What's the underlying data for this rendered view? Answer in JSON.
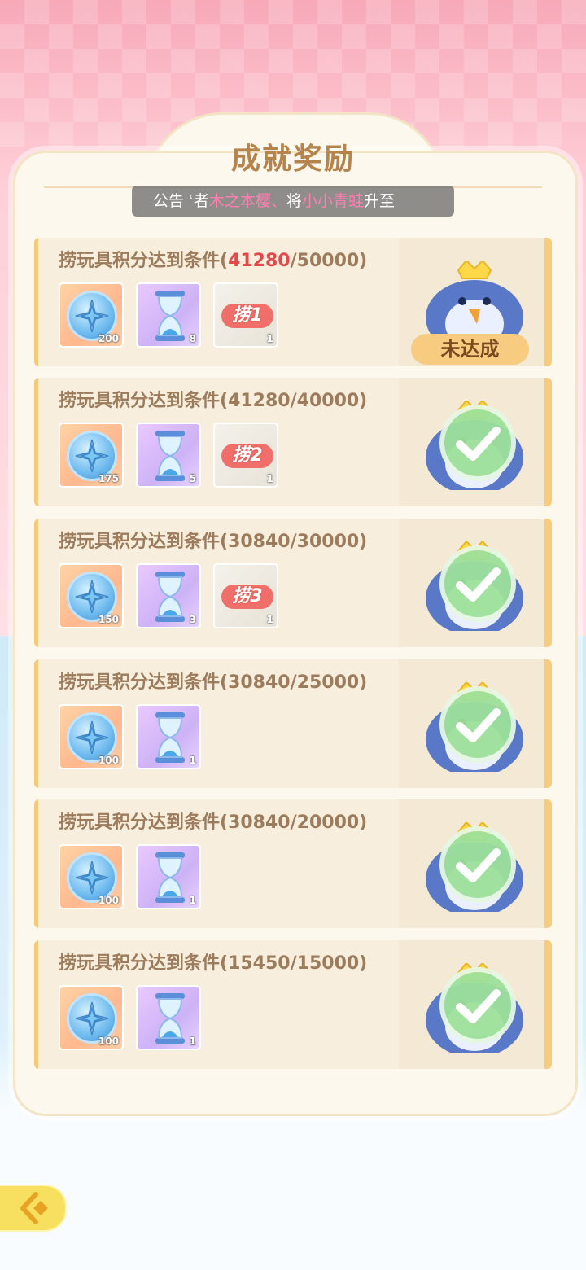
{
  "title": "成就奖励",
  "notice": {
    "label": "公告",
    "text_parts": [
      "ʿ者",
      "木之本樱、",
      "将",
      "小小青蛙",
      "升至"
    ]
  },
  "rows": [
    {
      "condition": "捞玩具积分达到条件(",
      "current": "41280",
      "target": "/50000)",
      "reached": false,
      "status": "未达成",
      "items": [
        {
          "type": "coin",
          "qty": "200"
        },
        {
          "type": "hourglass",
          "qty": "8"
        },
        {
          "type": "ticket",
          "label": "捞1",
          "qty": "1"
        }
      ]
    },
    {
      "condition": "捞玩具积分达到条件(",
      "current": "41280",
      "target": "/40000)",
      "reached": true,
      "items": [
        {
          "type": "coin",
          "qty": "175"
        },
        {
          "type": "hourglass",
          "qty": "5"
        },
        {
          "type": "ticket",
          "label": "捞2",
          "qty": "1"
        }
      ]
    },
    {
      "condition": "捞玩具积分达到条件(",
      "current": "30840",
      "target": "/30000)",
      "reached": true,
      "items": [
        {
          "type": "coin",
          "qty": "150"
        },
        {
          "type": "hourglass",
          "qty": "3"
        },
        {
          "type": "ticket",
          "label": "捞3",
          "qty": "1"
        }
      ]
    },
    {
      "condition": "捞玩具积分达到条件(",
      "current": "30840",
      "target": "/25000)",
      "reached": true,
      "items": [
        {
          "type": "coin",
          "qty": "100"
        },
        {
          "type": "hourglass",
          "qty": "1"
        }
      ]
    },
    {
      "condition": "捞玩具积分达到条件(",
      "current": "30840",
      "target": "/20000)",
      "reached": true,
      "items": [
        {
          "type": "coin",
          "qty": "100"
        },
        {
          "type": "hourglass",
          "qty": "1"
        }
      ]
    },
    {
      "condition": "捞玩具积分达到条件(",
      "current": "15450",
      "target": "/15000)",
      "reached": true,
      "items": [
        {
          "type": "coin",
          "qty": "100"
        },
        {
          "type": "hourglass",
          "qty": "1"
        }
      ]
    }
  ],
  "colors": {
    "accent_red": "#e04a4a",
    "highlight_pink": "#ff7fb3",
    "check_green": "#8edb86"
  },
  "icons": {
    "back": "back-arrow-icon",
    "coin": "star-compass-coin-icon",
    "hourglass": "hourglass-icon",
    "mascot": "penguin-mascot-icon",
    "check": "checkmark-icon"
  }
}
